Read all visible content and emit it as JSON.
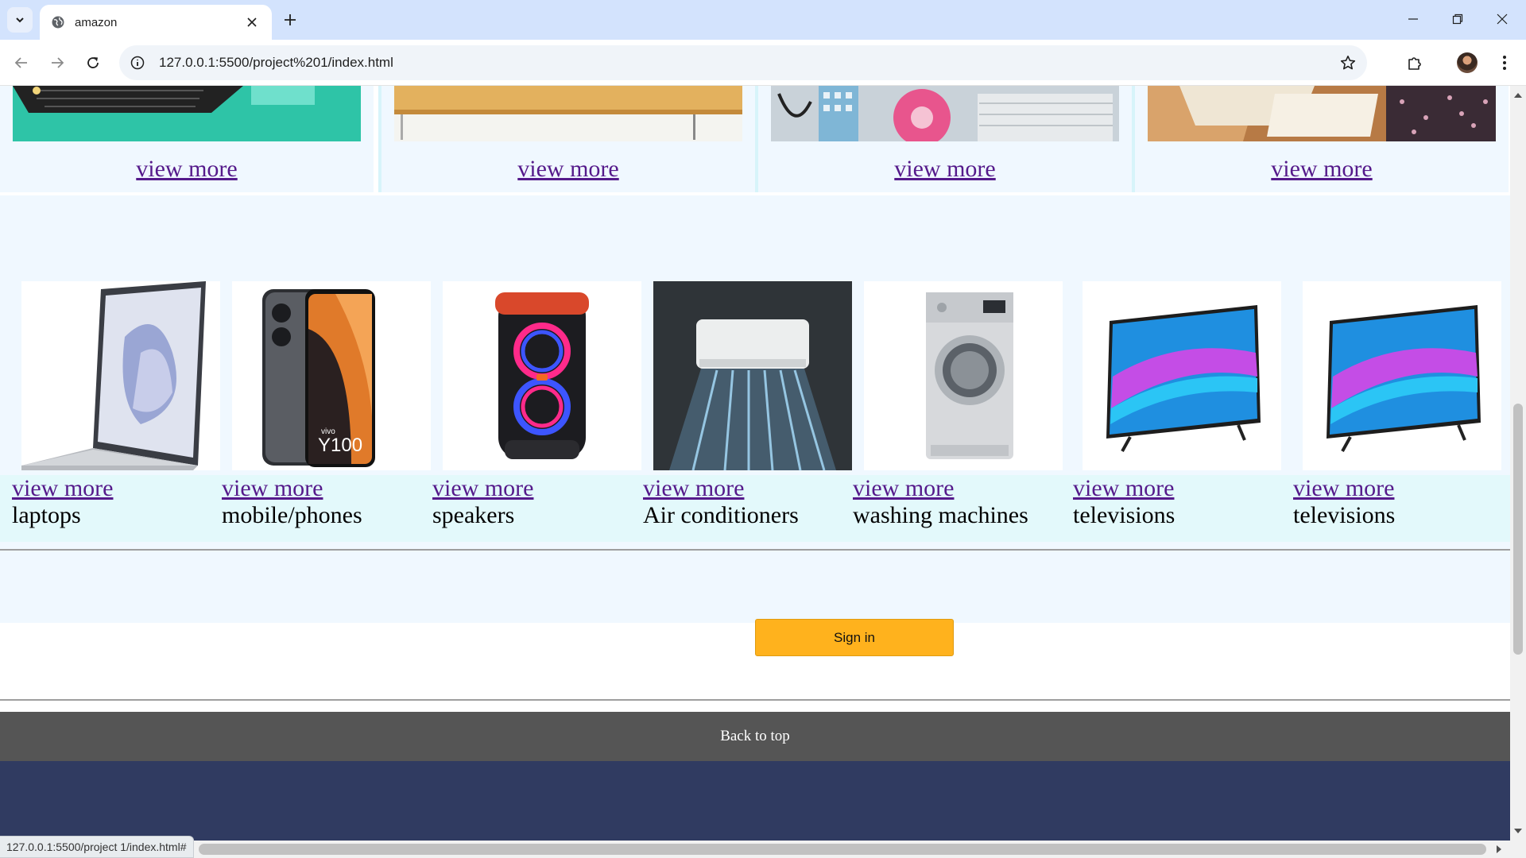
{
  "browser": {
    "tab_title": "amazon",
    "url": "127.0.0.1:5500/project%201/index.html",
    "status_url": "127.0.0.1:5500/project 1/index.html#"
  },
  "top_cards": [
    {
      "link": "view more",
      "image": "keyboard-image"
    },
    {
      "link": "view more",
      "image": "desk-image"
    },
    {
      "link": "view more",
      "image": "office-supplies-image"
    },
    {
      "link": "view more",
      "image": "papers-image"
    }
  ],
  "products": [
    {
      "link": "view more",
      "label": "laptops",
      "image": "laptop-image"
    },
    {
      "link": "view more",
      "label": "mobile/phones",
      "image": "phone-image"
    },
    {
      "link": "view more",
      "label": "speakers",
      "image": "speaker-image"
    },
    {
      "link": "view more",
      "label": "Air conditioners",
      "image": "air-conditioner-image"
    },
    {
      "link": "view more",
      "label": "washing machines",
      "image": "washing-machine-image"
    },
    {
      "link": "view more",
      "label": "televisions",
      "image": "television-image"
    },
    {
      "link": "view more",
      "label": "televisions",
      "image": "television-image"
    }
  ],
  "phone_brand": "vivo",
  "phone_model": "Y100",
  "sign_in_label": "Sign in",
  "back_to_top_label": "Back to top",
  "colors": {
    "sign_in_button": "#ffb21d",
    "back_to_top_bar": "#555555",
    "footer": "#303b61",
    "link": "#551a8b"
  }
}
